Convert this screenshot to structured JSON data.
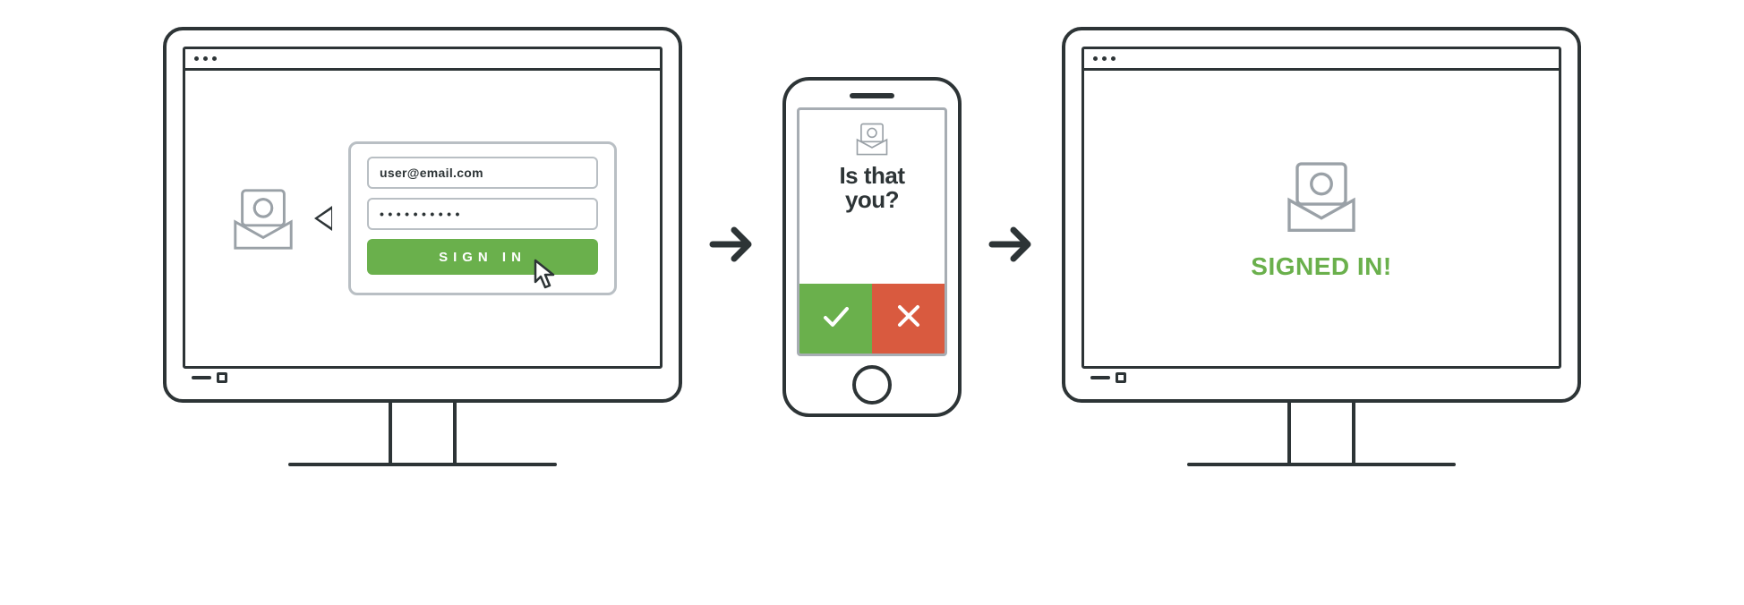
{
  "step1": {
    "email_value": "user@email.com",
    "password_mask": "• • • • • • • • • •",
    "signin_label": "SIGN IN"
  },
  "phone": {
    "prompt_line1": "Is that",
    "prompt_line2": "you?"
  },
  "step3": {
    "success_label": "SIGNED IN!"
  },
  "icons": {
    "email": "at-envelope-icon",
    "cursor": "cursor-icon",
    "arrow": "arrow-right-icon",
    "check": "check-icon",
    "cross": "cross-icon"
  },
  "colors": {
    "stroke": "#2d3436",
    "green": "#6ab04c",
    "red": "#d95a3f",
    "grey": "#a7adb3"
  }
}
